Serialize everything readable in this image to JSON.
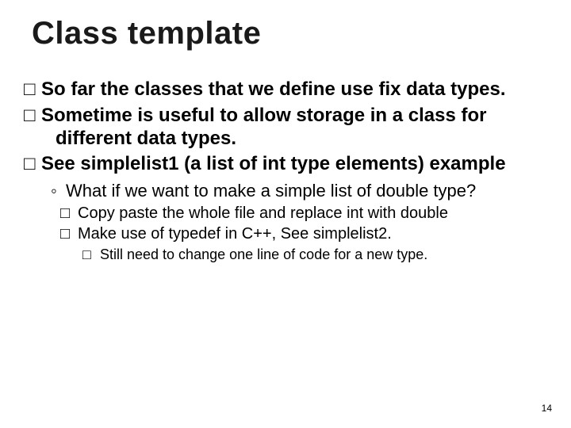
{
  "title": "Class template",
  "bullets": {
    "a": "So far the classes that we define use fix data types.",
    "b": "Sometime is useful to allow storage in a class for different data types.",
    "c": "See simplelist1 (a list of int type elements) example",
    "c_sub": "What if we want to make a simple list of double type?",
    "c_sub_1": "Copy paste the whole file and replace int with double",
    "c_sub_2": "Make use of typedef in C++, See simplelist2.",
    "c_sub_2_i": "Still need to change one line of code for a new type."
  },
  "glyphs": {
    "box": "□",
    "diamond": "◦"
  },
  "page_number": "14"
}
